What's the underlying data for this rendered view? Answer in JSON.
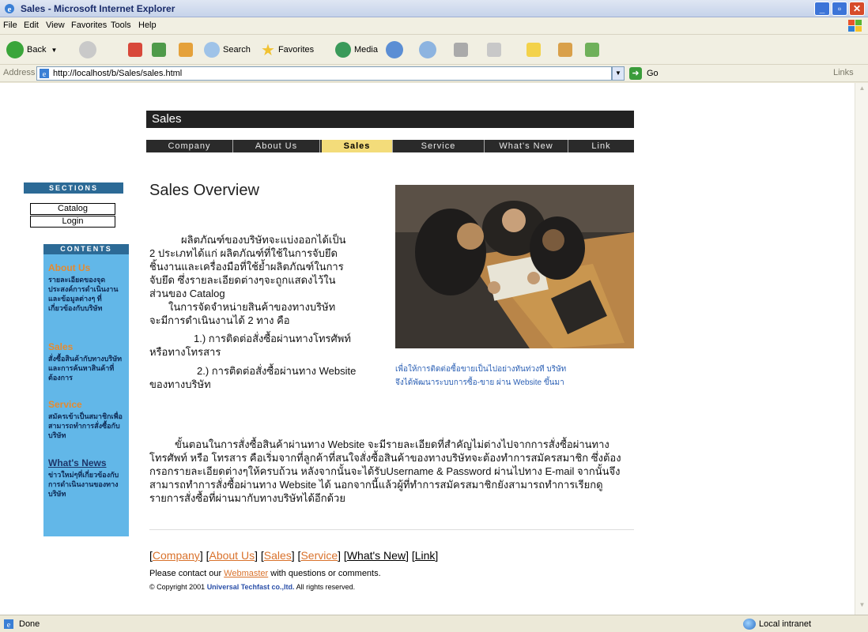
{
  "window": {
    "title": "Sales - Microsoft Internet Explorer",
    "minimize_label": "_",
    "maximize_label": "▫",
    "close_label": "✕"
  },
  "menubar": {
    "items": [
      "File",
      "Edit",
      "View",
      "Favorites",
      "Tools",
      "Help"
    ]
  },
  "toolbar": {
    "back_label": "Back",
    "search_label": "Search",
    "favorites_label": "Favorites",
    "media_label": "Media"
  },
  "address": {
    "label": "Address",
    "url": "http://localhost/b/Sales/sales.html",
    "go_label": "Go",
    "links_label": "Links"
  },
  "page": {
    "banner_title": "Sales",
    "nav": [
      "Company",
      "About Us",
      "Sales",
      "Service",
      "What's New",
      "Link"
    ],
    "active_nav": "Sales",
    "sidebar": {
      "sections_header": "SECTIONS",
      "catalog_label": "Catalog",
      "login_label": "Login",
      "contents_header": "CONTENTS",
      "items": [
        {
          "title": "About Us",
          "desc": "รายละเอียดของจุดประสงค์การดำเนินงานและข้อมูลต่างๆ ที่เกี่ยวข้องกับบริษัท"
        },
        {
          "title": "Sales",
          "desc": "สั่งซื้อสินค้ากับทางบริษัทและการค้นหาสินค้าที่ต้องการ"
        },
        {
          "title": "Service",
          "desc": "สมัครเข้าเป็นสมาชิกเพื่อสามารถทำการสั่งซื้อกับบริษัท"
        },
        {
          "title": "What's News",
          "desc": "ข่าวใหม่ๆที่เกี่ยวข้องกับการดำเนินงานของทางบริษัท"
        }
      ]
    },
    "heading": "Sales Overview",
    "intro_lines": [
      "ผลิตภัณฑ์ของบริษัทจะแบ่งออกได้เป็น",
      "2 ประเภทได้แก่ ผลิตภัณฑ์ที่ใช้ในการจับยึด",
      "ชิ้นงานและเครื่องมือที่ใช้ย้ำผลิตภัณฑ์ในการ",
      "จับยึด ซึ่งรายละเอียดต่างๆจะถูกแสดงไว้ใน",
      "ส่วนของ Catalog",
      "ในการจัดจำหน่ายสินค้าของทางบริษัท",
      "จะมีการดำเนินงานได้ 2 ทาง คือ",
      "1.) การติดต่อสั่งซื้อผ่านทางโทรศัพท์",
      "หรือทางโทรสาร",
      "2.) การติดต่อสั่งซื้อผ่านทาง Website",
      "ของทางบริษัท"
    ],
    "caption_lines": [
      "เพื่อให้การติดต่อซื้อขายเป็นไปอย่างทันท่วงที บริษัท",
      "จึงได้พัฒนาระบบการซื้อ-ขาย ผ่าน Website ขึ้นมา"
    ],
    "body_text": "ขั้นตอนในการสั่งซื้อสินค้าผ่านทาง Website จะมีรายละเอียดที่สำคัญไม่ต่างไปจากการสั่งซื้อผ่านทางโทรศัพท์ หรือ โทรสาร คือเริ่มจากที่ลูกค้าที่สนใจสั่งซื้อสินค้าของทางบริษัทจะต้องทำการสมัครสมาชิก ซึ่งต้องกรอกรายละเอียดต่างๆให้ครบถ้วน หลังจากนั้นจะได้รับUsername & Password ผ่านไปทาง E-mail จากนั้นจึงสามารถทำการสั่งซื้อผ่านทาง Website ได้ นอกจากนี้แล้วผู้ที่ทำการสมัครสมาชิกยังสามารถทำการเรียกดูรายการสั่งซื้อที่ผ่านมากับทางบริษัทได้อีกด้วย",
    "footer_links": [
      "Company",
      "About Us",
      "Sales",
      "Service",
      "What's New",
      "Link"
    ],
    "contact_prefix": "Please contact our ",
    "contact_link": "Webmaster",
    "contact_suffix": " with questions or comments.",
    "copyright_prefix": "© Copyright 2001 ",
    "copyright_company": "Universal Techfast co.,ltd.",
    "copyright_suffix": " All rights reserved."
  },
  "statusbar": {
    "status": "Done",
    "zone": "Local intranet"
  }
}
